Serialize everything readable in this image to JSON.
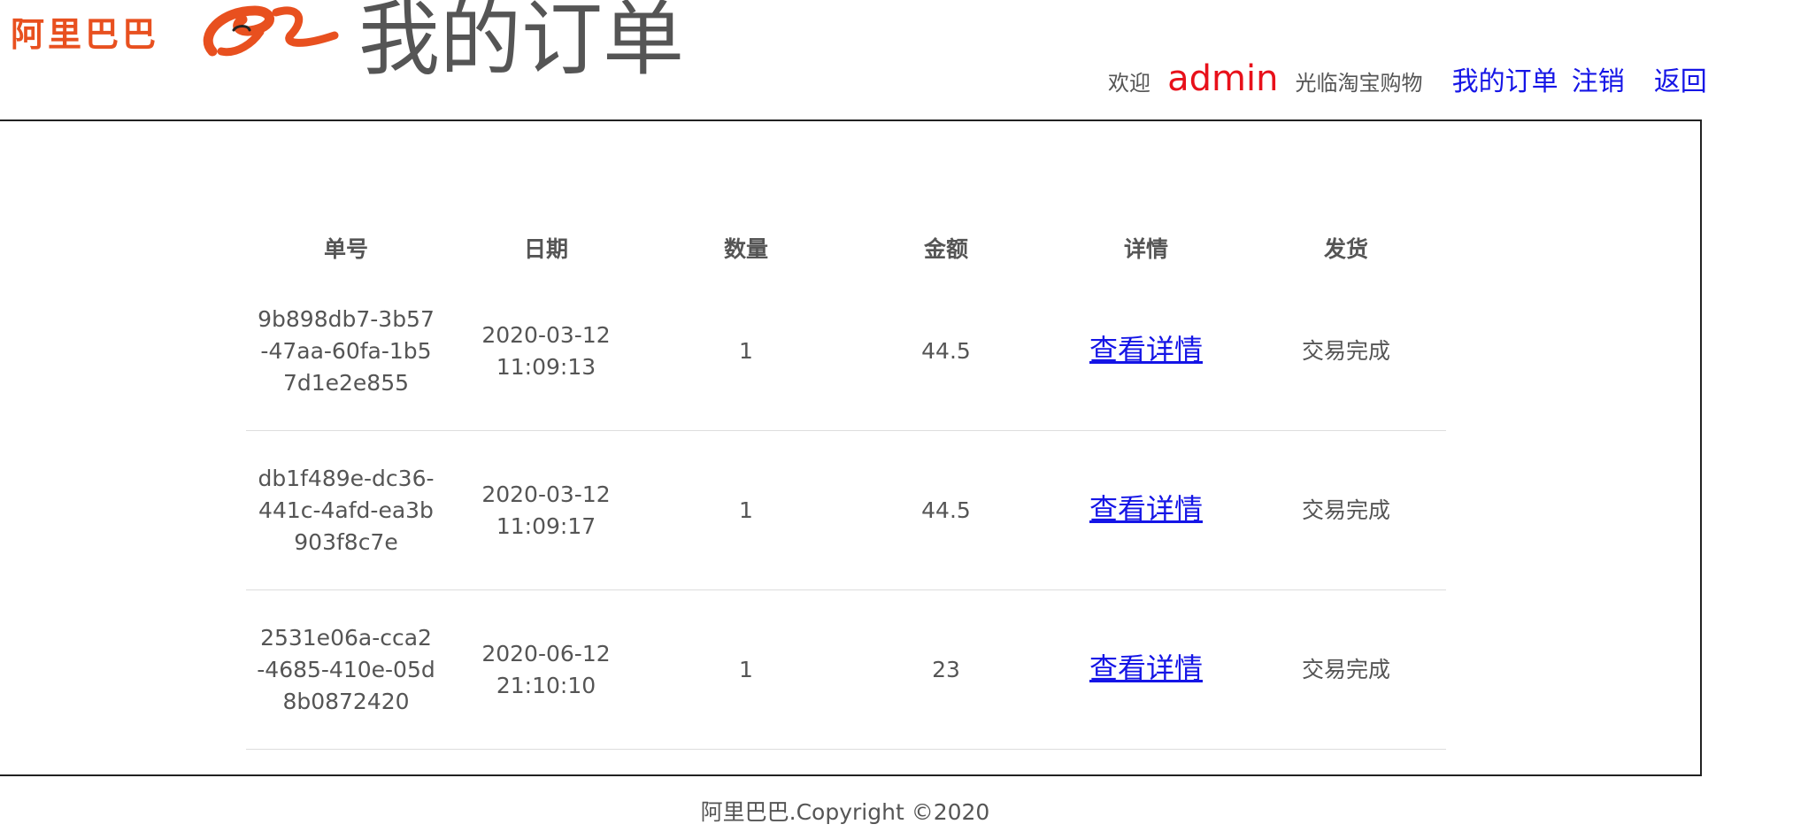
{
  "brand": {
    "name": "阿里巴巴",
    "accent": "#e8501f"
  },
  "title": "我的订单",
  "nav": {
    "welcome_prefix": "欢迎",
    "username": "admin",
    "welcome_suffix": "光临淘宝购物",
    "links": [
      {
        "label": "我的订单"
      },
      {
        "label": "注销"
      },
      {
        "label": "返回"
      }
    ],
    "link_color": "#1515e6",
    "username_color": "#e8101a"
  },
  "table": {
    "headers": [
      "单号",
      "日期",
      "数量",
      "金额",
      "详情",
      "发货"
    ],
    "rows": [
      {
        "id": "9b898db7-3b57-47aa-60fa-1b57d1e2e855",
        "date": "2020-03-12 11:09:13",
        "qty": "1",
        "amount": "44.5",
        "detail": "查看详情",
        "status": "交易完成"
      },
      {
        "id": "db1f489e-dc36-441c-4afd-ea3b903f8c7e",
        "date": "2020-03-12 11:09:17",
        "qty": "1",
        "amount": "44.5",
        "detail": "查看详情",
        "status": "交易完成"
      },
      {
        "id": "2531e06a-cca2-4685-410e-05d8b0872420",
        "date": "2020-06-12 21:10:10",
        "qty": "1",
        "amount": "23",
        "detail": "查看详情",
        "status": "交易完成"
      }
    ]
  },
  "footer": "阿里巴巴.Copyright ©2020"
}
